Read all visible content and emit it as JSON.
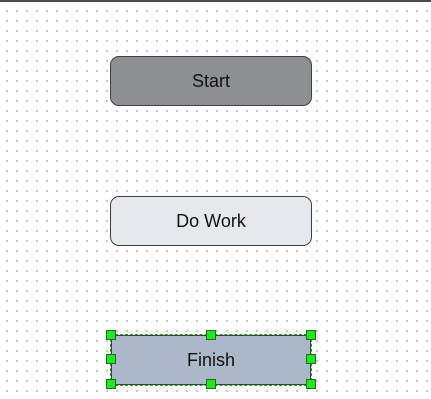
{
  "diagram": {
    "nodes": [
      {
        "id": "start",
        "label": "Start",
        "shape": "rounded-rectangle",
        "fill": "#8e8f93",
        "selected": false
      },
      {
        "id": "do_work",
        "label": "Do Work",
        "shape": "rounded-rectangle",
        "fill": "#e5e9ee",
        "selected": false
      },
      {
        "id": "finish",
        "label": "Finish",
        "shape": "rectangle",
        "fill": "#aab8c7",
        "selected": true
      }
    ],
    "selection": {
      "outline_color": "#1a9e1a",
      "handle_color": "#22e622",
      "handles": [
        "nw",
        "n",
        "ne",
        "w",
        "e",
        "sw",
        "s",
        "se"
      ]
    },
    "grid": {
      "visible": true,
      "style": "dotted",
      "dot_color": "#b8b8b8"
    }
  }
}
